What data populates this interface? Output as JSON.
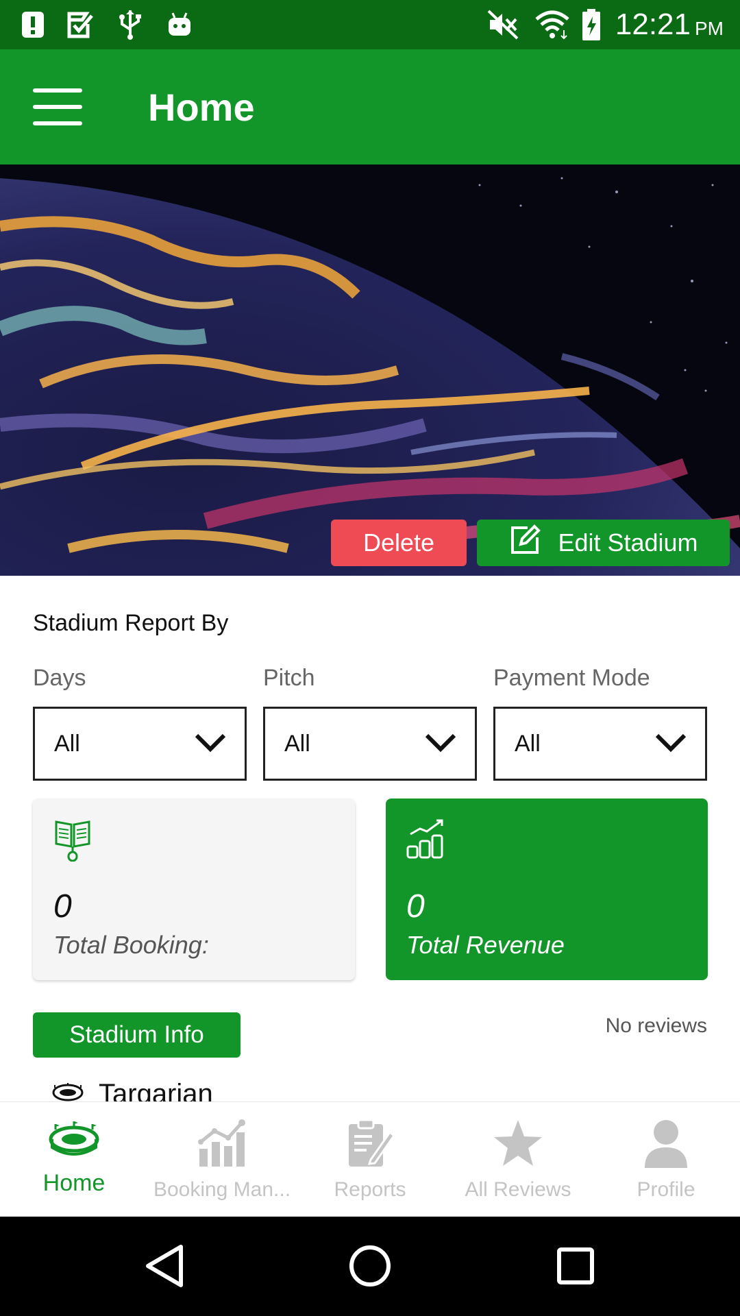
{
  "status_bar": {
    "time": "12:21",
    "ampm": "PM",
    "left_icons": [
      "alert-icon",
      "check-icon",
      "usb-icon",
      "android-icon"
    ],
    "right_icons": [
      "mute-icon",
      "wifi-icon",
      "battery-charging-icon"
    ]
  },
  "app_bar": {
    "title": "Home",
    "menu_icon": "menu-icon"
  },
  "banner": {
    "image": "planet-wallpaper",
    "delete_label": "Delete",
    "edit_label": "Edit Stadium",
    "colors": {
      "delete": "#ee4b55",
      "edit": "#12962a"
    }
  },
  "report": {
    "heading": "Stadium Report By",
    "filters": [
      {
        "label": "Days",
        "value": "All"
      },
      {
        "label": "Pitch",
        "value": "All"
      },
      {
        "label": "Payment Mode",
        "value": "All"
      }
    ],
    "cards": {
      "booking": {
        "value": "0",
        "label": "Total Booking:",
        "icon": "book-mouse-icon"
      },
      "revenue": {
        "value": "0",
        "label": "Total Revenue",
        "icon": "coins-growth-icon"
      }
    }
  },
  "stadium": {
    "info_button": "Stadium Info",
    "reviews_text": "No reviews",
    "name": "Targarian"
  },
  "bottom_nav": {
    "items": [
      {
        "label": "Home",
        "icon": "stadium-icon",
        "active": true
      },
      {
        "label": "Booking Man...",
        "icon": "bar-chart-icon",
        "active": false
      },
      {
        "label": "Reports",
        "icon": "clipboard-icon",
        "active": false
      },
      {
        "label": "All Reviews",
        "icon": "star-icon",
        "active": false
      },
      {
        "label": "Profile",
        "icon": "person-icon",
        "active": false
      }
    ],
    "colors": {
      "active": "#12962a",
      "inactive": "#c4c4c4"
    }
  },
  "theme": {
    "primary": "#12962a",
    "status_bar": "#0b6b14"
  }
}
